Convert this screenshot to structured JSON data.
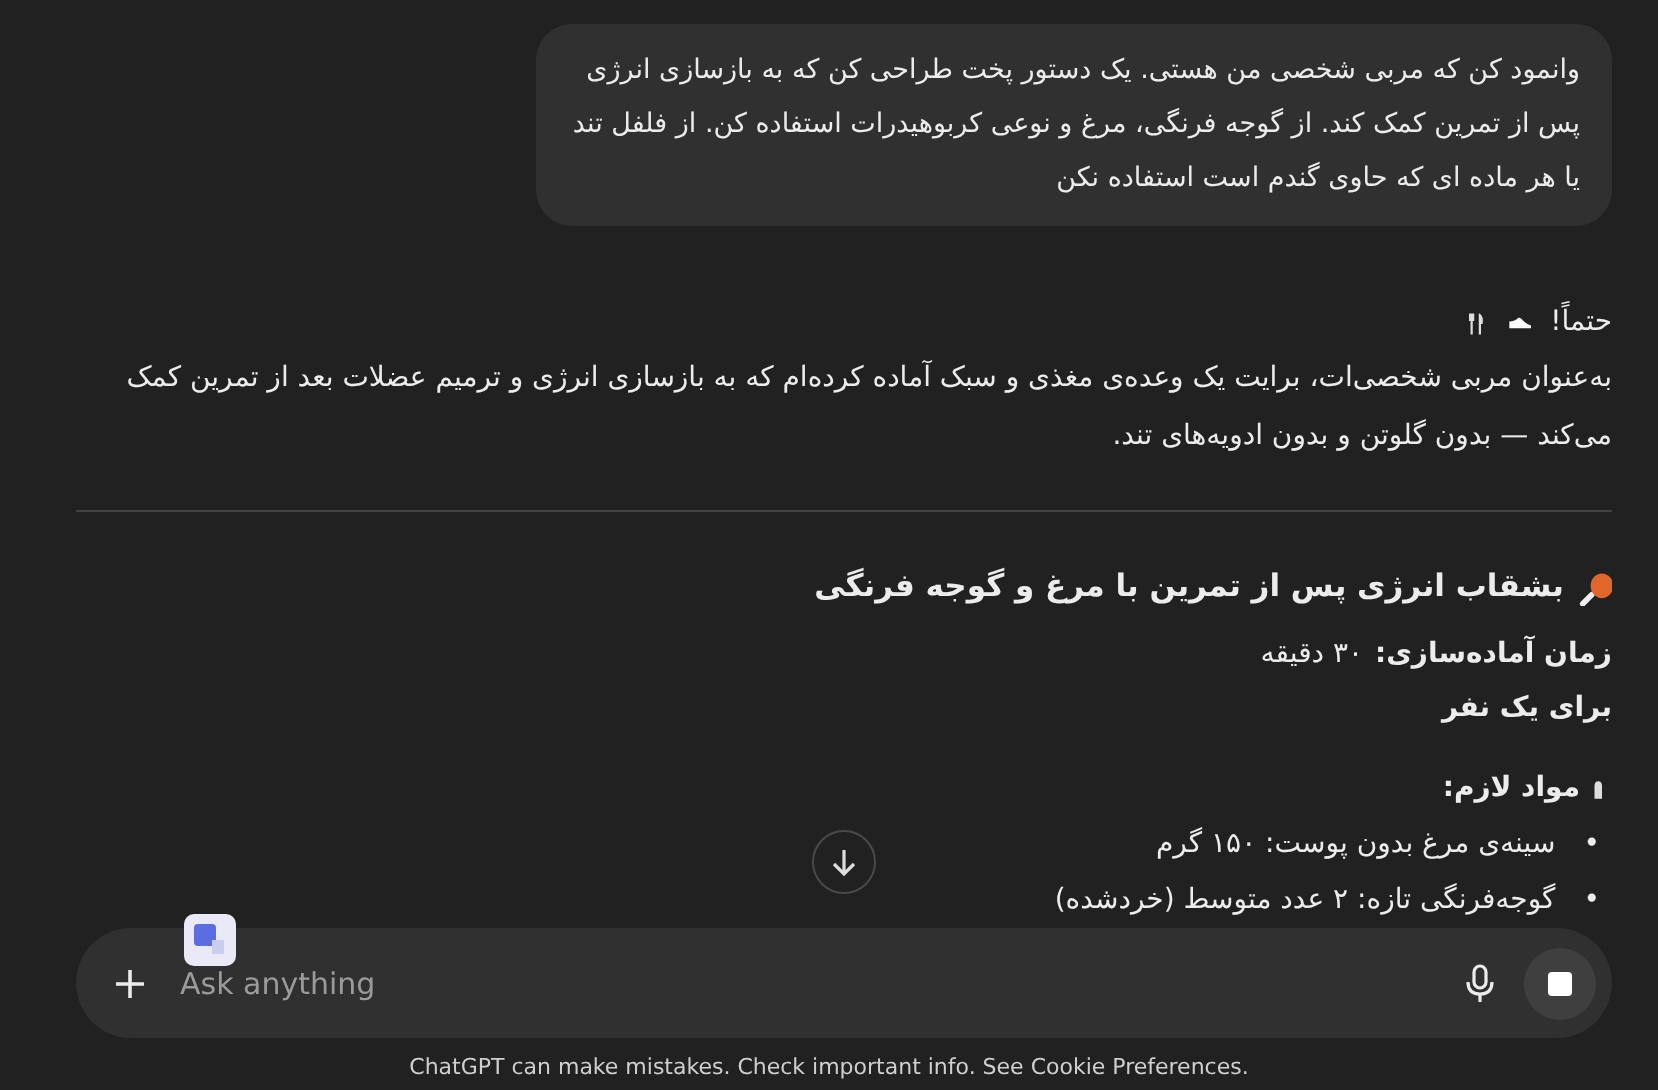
{
  "user_message": "وانمود کن که مربی شخصی من هستی. یک دستور پخت طراحی کن که به بازسازی انرژی پس از تمرین کمک کند. از گوجه فرنگی، مرغ و نوعی کربوهیدرات استفاده کن. از فلفل تند یا هر ماده ای که حاوی گندم است استفاده نکن",
  "reply": {
    "greeting": "حتماً!",
    "intro": "به‌عنوان مربی شخصی‌ات، برایت یک وعده‌ی مغذی و سبک آماده کرده‌ام که به بازسازی انرژی و ترمیم عضلات بعد از تمرین کمک می‌کند — بدون گلوتن و بدون ادویه‌های تند.",
    "recipe_title": "بشقاب انرژی پس از تمرین با مرغ و گوجه فرنگی",
    "prep_label": "زمان آماده‌سازی:",
    "prep_value": "۳۰ دقیقه",
    "serves": "برای یک نفر",
    "ingredients_title": "مواد لازم:",
    "ingredients": [
      {
        "bullet": "•",
        "text": "سینه‌ی مرغ بدون پوست: ۱۵۰ گرم"
      },
      {
        "bullet": "•",
        "text": "گوجه‌فرنگی تازه: ۲ عدد متوسط (خردشده)"
      }
    ]
  },
  "composer": {
    "placeholder": "Ask anything"
  },
  "footer": "ChatGPT can make mistakes. Check important info. See Cookie Preferences."
}
